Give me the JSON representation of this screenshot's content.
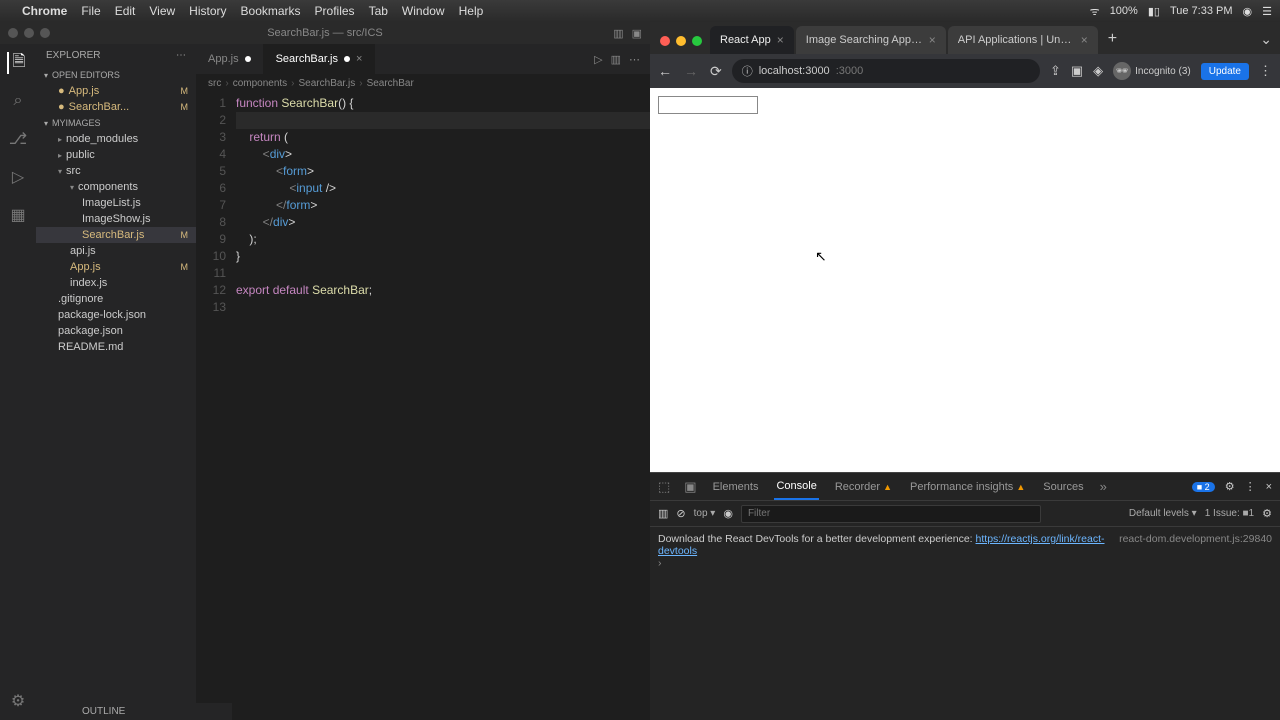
{
  "menubar": {
    "app": "Chrome",
    "items": [
      "File",
      "Edit",
      "View",
      "History",
      "Bookmarks",
      "Profiles",
      "Tab",
      "Window",
      "Help"
    ],
    "battery": "100%",
    "clock": "Tue 7:33 PM"
  },
  "vscode": {
    "title": "SearchBar.js — src/ICS",
    "explorer_label": "EXPLORER",
    "open_editors_label": "OPEN EDITORS",
    "project_label": "MYIMAGES",
    "outline_label": "OUTLINE",
    "open_editors": [
      {
        "name": "App.js",
        "modified": true
      },
      {
        "name": "SearchBar...",
        "modified": true
      }
    ],
    "tree": {
      "node_modules": "node_modules",
      "public": "public",
      "src": "src",
      "components": "components",
      "files_components": [
        {
          "name": "ImageList.js",
          "modified": false
        },
        {
          "name": "ImageShow.js",
          "modified": false
        },
        {
          "name": "SearchBar.js",
          "modified": true
        }
      ],
      "files_src": [
        {
          "name": "api.js"
        },
        {
          "name": "App.js",
          "modified": true
        },
        {
          "name": "index.js"
        }
      ],
      "files_root": [
        {
          "name": ".gitignore"
        },
        {
          "name": "package-lock.json"
        },
        {
          "name": "package.json"
        },
        {
          "name": "README.md"
        }
      ]
    },
    "tabs": [
      {
        "label": "App.js",
        "active": false,
        "modified": true
      },
      {
        "label": "SearchBar.js",
        "active": true,
        "modified": true
      }
    ],
    "breadcrumb": [
      "src",
      "components",
      "SearchBar.js",
      "SearchBar"
    ],
    "code_lines": [
      "function SearchBar() {",
      "",
      "    return (",
      "        <div>",
      "            <form>",
      "                <input />",
      "            </form>",
      "        </div>",
      "    );",
      "}",
      "",
      "export default SearchBar;",
      ""
    ]
  },
  "chrome": {
    "tabs": [
      {
        "label": "React App",
        "active": true
      },
      {
        "label": "Image Searching App | Interv...",
        "active": false
      },
      {
        "label": "API Applications | Unsplash",
        "active": false
      }
    ],
    "url": "localhost:3000",
    "profile": "Incognito (3)",
    "update_label": "Update"
  },
  "devtools": {
    "tabs": [
      "Elements",
      "Console",
      "Recorder",
      "Performance insights",
      "Sources"
    ],
    "active_tab": "Console",
    "issues_count": "2",
    "filter_placeholder": "Filter",
    "top_label": "top",
    "levels_label": "Default levels",
    "issue_label": "1 Issue:",
    "log_source": "react-dom.development.js:29840",
    "log_text": "Download the React DevTools for a better development experience:",
    "log_link": "https://reactjs.org/link/react-devtools"
  }
}
